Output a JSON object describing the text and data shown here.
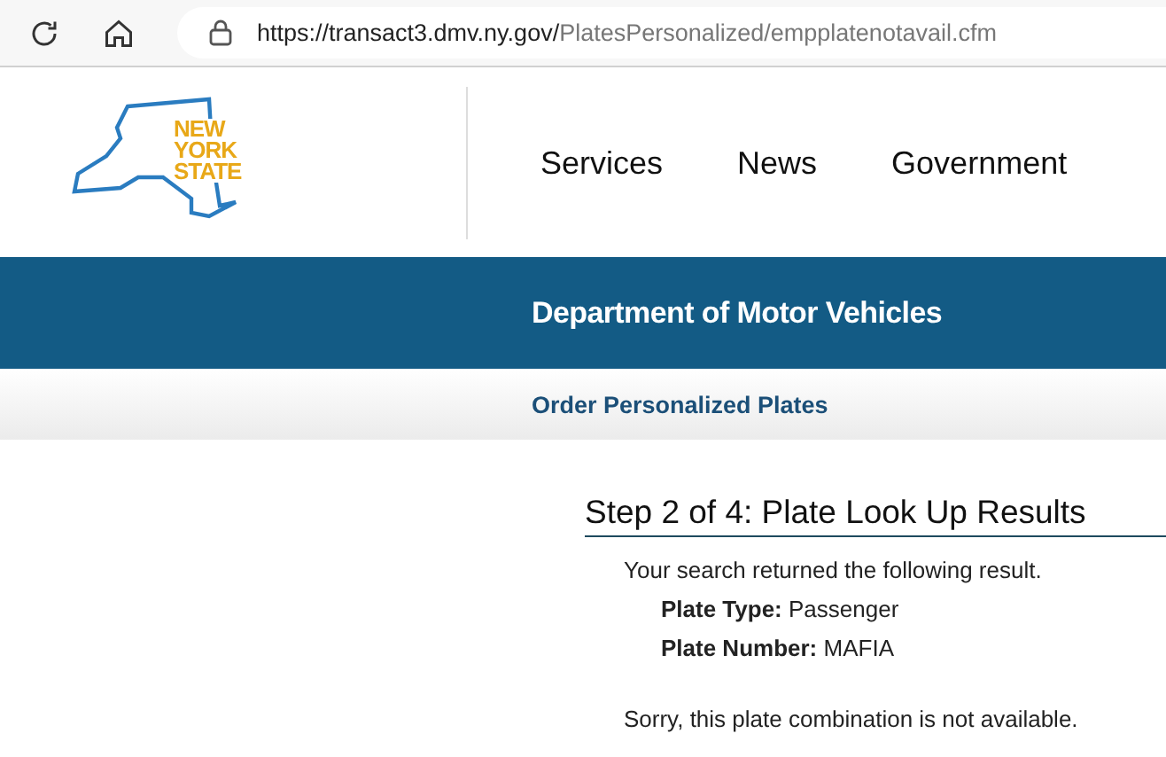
{
  "browser": {
    "url_host": "https://transact3.dmv.ny.gov/",
    "url_path": "PlatesPersonalized/empplatenotavail.cfm"
  },
  "header": {
    "logo_lines": [
      "NEW",
      "YORK",
      "STATE"
    ],
    "nav": [
      "Services",
      "News",
      "Government"
    ]
  },
  "banner": {
    "title": "Department of Motor Vehicles"
  },
  "subnav": {
    "title": "Order Personalized Plates"
  },
  "content": {
    "heading": "Step 2 of 4: Plate Look Up Results",
    "intro": "Your search returned the following result.",
    "fields": [
      {
        "label": "Plate Type:",
        "value": "Passenger"
      },
      {
        "label": "Plate Number:",
        "value": "MAFIA"
      }
    ],
    "message": "Sorry, this plate combination is not available."
  }
}
